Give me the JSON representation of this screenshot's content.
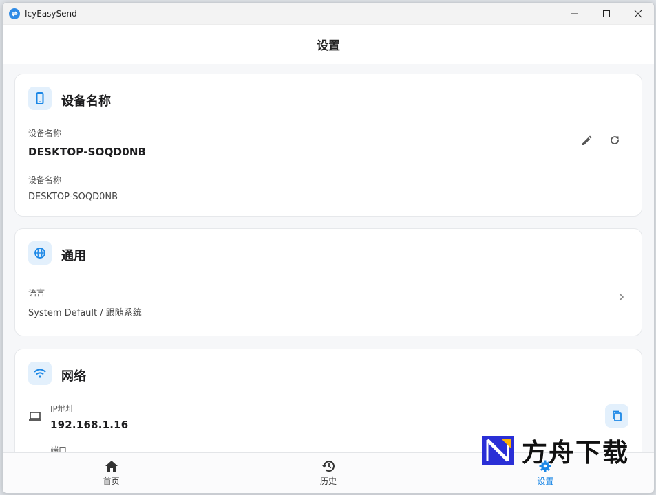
{
  "window": {
    "title": "IcyEasySend"
  },
  "header": {
    "title": "设置"
  },
  "device_card": {
    "title": "设备名称",
    "field1_label": "设备名称",
    "field1_value": "DESKTOP-SOQD0NB",
    "field2_label": "设备名称",
    "field2_value": "DESKTOP-SOQD0NB"
  },
  "general_card": {
    "title": "通用",
    "language_label": "语言",
    "language_value": "System Default / 跟随系统"
  },
  "network_card": {
    "title": "网络",
    "ip_label": "IP地址",
    "ip_value": "192.168.1.16",
    "port_label": "端口"
  },
  "nav": {
    "items": [
      {
        "label": "首页",
        "icon": "home-icon"
      },
      {
        "label": "历史",
        "icon": "history-icon"
      },
      {
        "label": "设置",
        "icon": "settings-icon",
        "active": true
      }
    ]
  },
  "watermark": {
    "text": "方舟下载"
  },
  "colors": {
    "accent": "#1b87e6",
    "icon_bg": "#e3f0fc"
  }
}
